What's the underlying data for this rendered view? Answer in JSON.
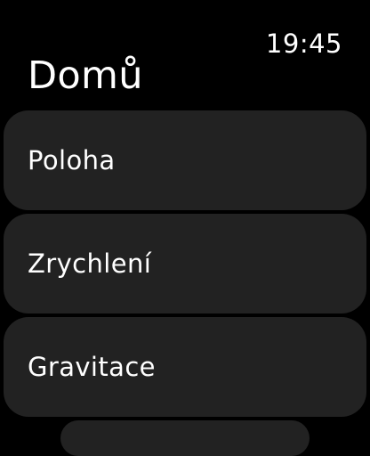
{
  "status": {
    "time": "19:45"
  },
  "header": {
    "title": "Domů"
  },
  "menu": {
    "items": [
      {
        "label": "Poloha"
      },
      {
        "label": "Zrychlení"
      },
      {
        "label": "Gravitace"
      }
    ]
  },
  "colors": {
    "background": "#000000",
    "row": "#222222",
    "text": "#ffffff"
  }
}
